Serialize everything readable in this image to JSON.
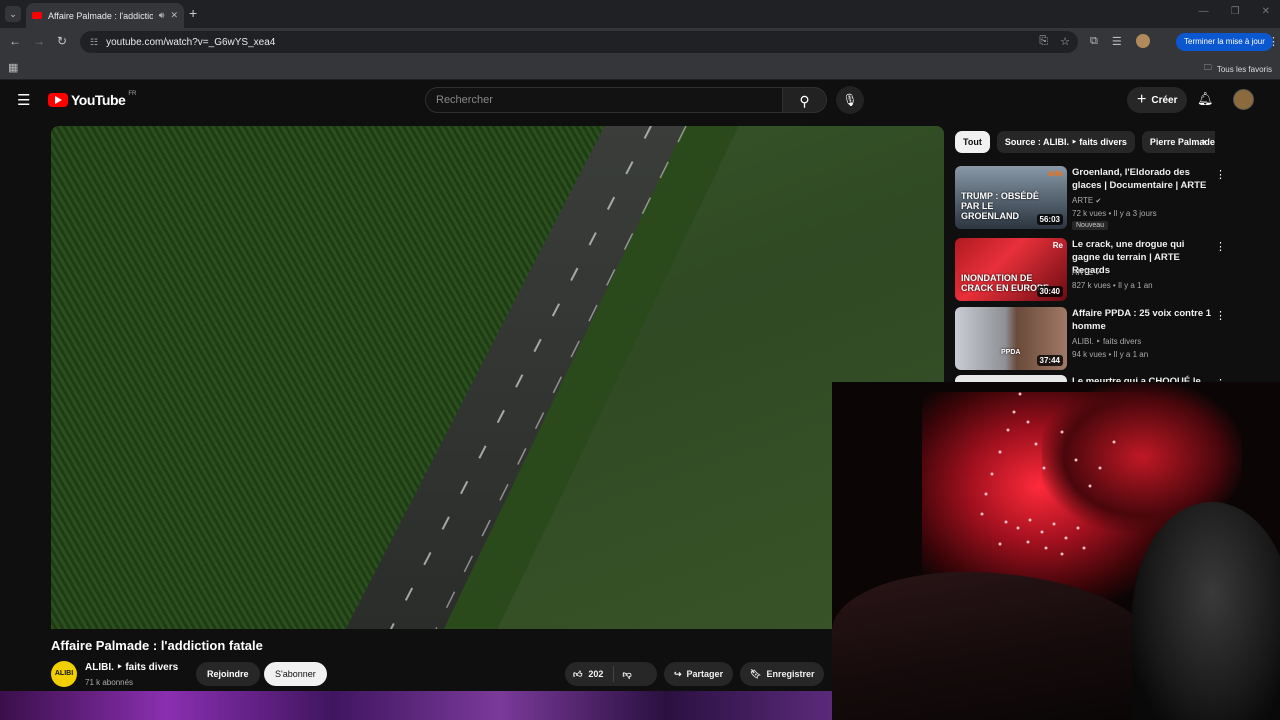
{
  "browser": {
    "tab_title": "Affaire Palmade : l'addictio",
    "url": "youtube.com/watch?v=_G6wYS_xea4",
    "update_label": "Terminer la mise à jour",
    "all_favorites_label": "Tous les favoris"
  },
  "header": {
    "logo_text": "YouTube",
    "country_code": "FR",
    "search_placeholder": "Rechercher",
    "create_label": "Créer"
  },
  "video": {
    "title": "Affaire Palmade : l'addiction fatale",
    "channel_avatar_text": "ALIBI",
    "channel_name": "ALIBI. ‣ faits divers",
    "subscribers": "71 k abonnés",
    "join_label": "Rejoindre",
    "subscribe_label": "S'abonner",
    "like_count": "202",
    "share_label": "Partager",
    "save_label": "Enregistrer"
  },
  "sidebar": {
    "chips": [
      "Tout",
      "Source : ALIBI. ‣ faits divers",
      "Pierre Palmade"
    ],
    "recommendations": [
      {
        "title": "Groenland, l'Eldorado des glaces | Documentaire | ARTE",
        "channel": "ARTE",
        "meta": "72 k vues • Il y a 3 jours",
        "badge": "Nouveau",
        "duration": "56:03",
        "thumb_text": "TRUMP : OBSÉDÉ PAR LE GROENLAND",
        "thumb_brand": "arte"
      },
      {
        "title": "Le crack, une drogue qui gagne du terrain | ARTE Regards",
        "channel": "ARTE",
        "meta": "827 k vues • Il y a 1 an",
        "duration": "30:40",
        "thumb_text": "INONDATION DE CRACK EN EUROPE",
        "thumb_brand": "Re"
      },
      {
        "title": "Affaire PPDA : 25 voix contre 1 homme",
        "channel": "ALIBI. ‣ faits divers",
        "meta": "94 k vues • Il y a 1 an",
        "duration": "37:44",
        "thumb_text": "PPDA",
        "thumb_brand": ""
      },
      {
        "title": "Le meurtre qui a CHOQUÉ le",
        "channel": "",
        "meta": "",
        "duration": "",
        "thumb_text": "",
        "thumb_brand": ""
      }
    ]
  },
  "colors": {
    "youtube_red": "#ff0000",
    "subscribe_bg": "#f1f1f1",
    "update_blue": "#0b57d0"
  }
}
